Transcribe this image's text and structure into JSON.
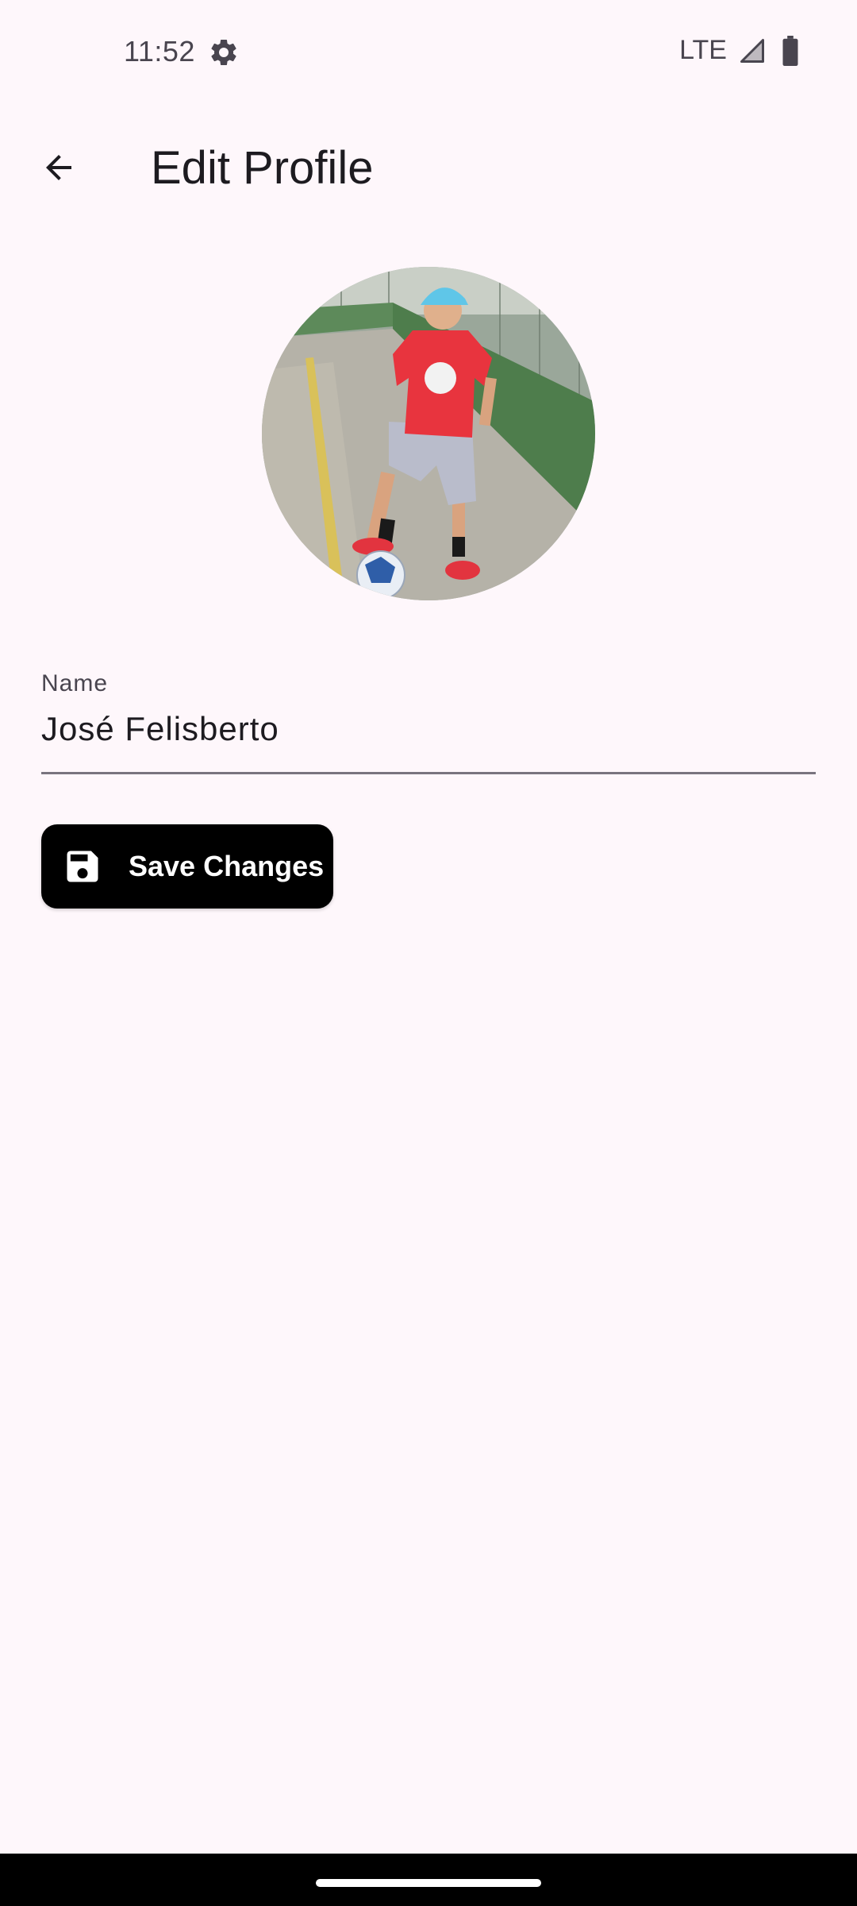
{
  "status_bar": {
    "time": "11:52",
    "network": "LTE",
    "icons": [
      "settings-gear-icon",
      "cell-signal-icon",
      "battery-icon"
    ]
  },
  "app_bar": {
    "back_icon": "arrow-back-icon",
    "title": "Edit Profile"
  },
  "profile": {
    "photo": "profile-photo"
  },
  "form": {
    "name_label": "Name",
    "name_value": "José Felisberto"
  },
  "actions": {
    "save_icon": "floppy-disk-icon",
    "save_label": "Save Changes"
  },
  "colors": {
    "background": "#fef7fb",
    "primary_button": "#000000",
    "text": "#1d1b20",
    "secondary_text": "#49454f"
  }
}
